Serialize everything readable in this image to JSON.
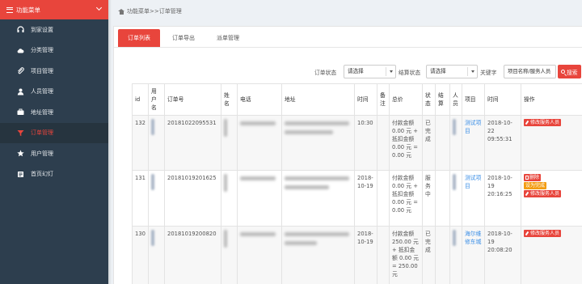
{
  "sidebar": {
    "header": "功能菜单",
    "items": [
      {
        "label": "到家设置",
        "icon": "headset-icon"
      },
      {
        "label": "分类管理",
        "icon": "cloud-icon"
      },
      {
        "label": "项目管理",
        "icon": "paperclip-icon"
      },
      {
        "label": "人员管理",
        "icon": "user-icon"
      },
      {
        "label": "地址管理",
        "icon": "briefcase-icon"
      },
      {
        "label": "订单管理",
        "icon": "filter-icon",
        "active": true
      },
      {
        "label": "用户管理",
        "icon": "star-icon"
      },
      {
        "label": "首页幻灯",
        "icon": "slides-icon"
      }
    ]
  },
  "breadcrumb": {
    "text": "功能菜单>>订单管理"
  },
  "tabs": [
    {
      "label": "订单列表",
      "active": true
    },
    {
      "label": "订单导出"
    },
    {
      "label": "派单管理"
    }
  ],
  "filters": {
    "order_status_label": "订单状态",
    "order_status_value": "请选择",
    "settle_status_label": "结算状态",
    "settle_status_value": "请选择",
    "keyword_label": "关键字",
    "keyword_placeholder": "项目名称/服务人员",
    "search_label": "搜索"
  },
  "table": {
    "headers": [
      "id",
      "用户名",
      "订单号",
      "姓名",
      "电话",
      "地址",
      "时间",
      "备注",
      "总价",
      "状态",
      "结算",
      "人员",
      "项目",
      "时间",
      "操作"
    ],
    "rows": [
      {
        "id": "132",
        "order_no": "20181022095531",
        "time": "10:30",
        "total": "付款金额 0.00 元 + 抵扣金额 0.00 元 = 0.00 元",
        "status": "已完成",
        "project": "测试项目",
        "created": "2018-10-22 09:55:31",
        "actions": [
          {
            "label": "修改服务人员",
            "kind": "red"
          }
        ]
      },
      {
        "id": "131",
        "order_no": "20181019201625",
        "time": "2018-10-19",
        "total": "付款金额 0.00 元 + 抵扣金额 0.00 元 = 0.00 元",
        "status": "服务中",
        "project": "测试项目",
        "created": "2018-10-19 20:16:25",
        "actions": [
          {
            "label": "删除",
            "kind": "red"
          },
          {
            "label": "设为完成",
            "kind": "orange"
          },
          {
            "label": "修改服务人员",
            "kind": "red"
          }
        ]
      },
      {
        "id": "130",
        "order_no": "20181019200820",
        "time": "2018-10-19",
        "total": "付款金额 250.00 元 + 抵扣金额 0.00 元 = 250.00 元",
        "status": "已完成",
        "project": "海尔维修东城",
        "created": "2018-10-19 20:08:20",
        "actions": [
          {
            "label": "修改服务人员",
            "kind": "red"
          }
        ]
      }
    ]
  },
  "colors": {
    "accent": "#e8453c",
    "sidebar": "#2d3e4e",
    "link": "#3a8ee6",
    "warning": "#f39c12"
  }
}
